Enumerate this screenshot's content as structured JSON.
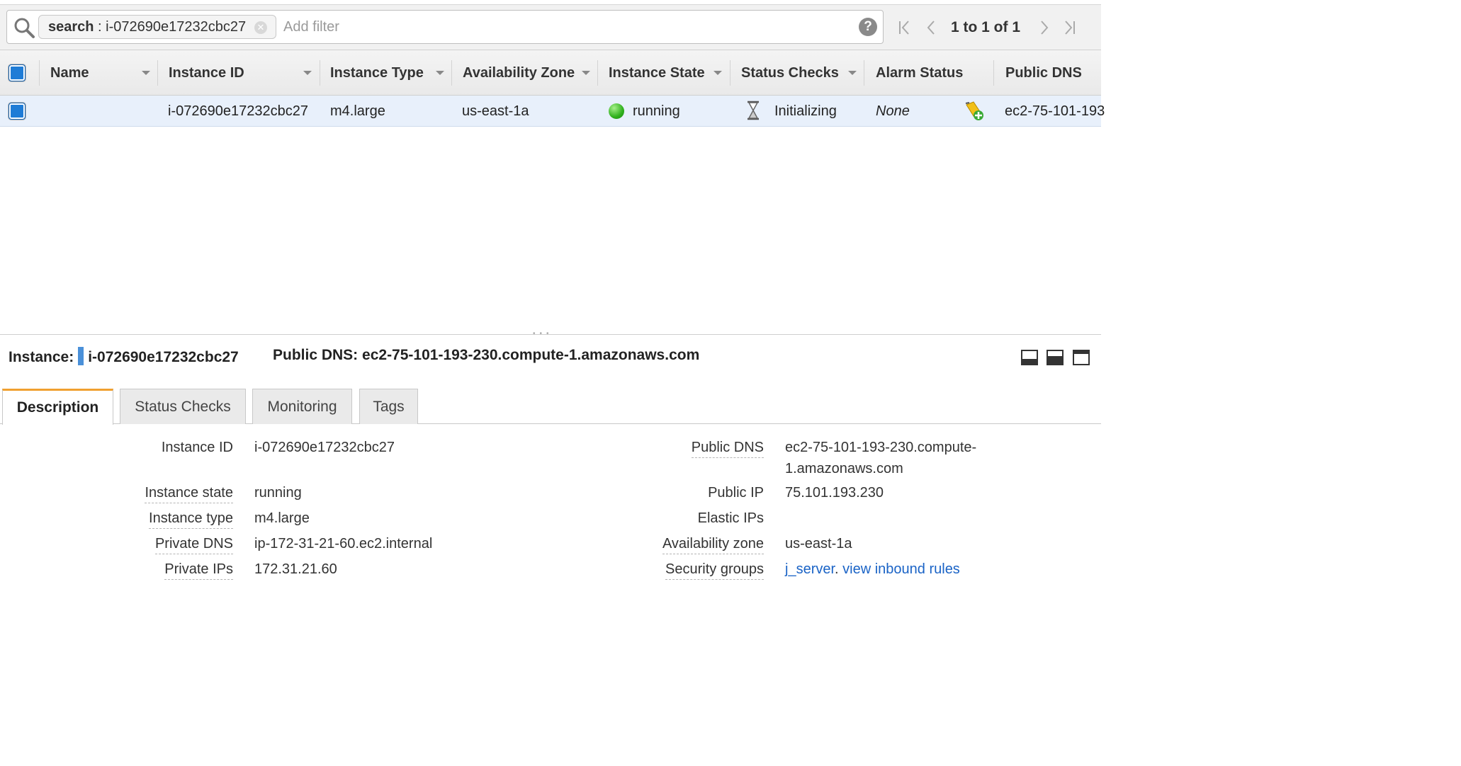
{
  "search": {
    "chip_key": "search",
    "chip_value": "i-072690e17232cbc27",
    "placeholder": "Add filter"
  },
  "pagination": {
    "text": "1 to 1 of 1"
  },
  "columns": {
    "name": "Name",
    "instance_id": "Instance ID",
    "instance_type": "Instance Type",
    "availability_zone": "Availability Zone",
    "instance_state": "Instance State",
    "status_checks": "Status Checks",
    "alarm_status": "Alarm Status",
    "public_dns": "Public DNS"
  },
  "rows": [
    {
      "name": "",
      "instance_id": "i-072690e17232cbc27",
      "instance_type": "m4.large",
      "availability_zone": "us-east-1a",
      "instance_state": "running",
      "status_checks": "Initializing",
      "alarm_status": "None",
      "public_dns": "ec2-75-101-193"
    }
  ],
  "detail": {
    "instance_label": "Instance:",
    "instance_id": "i-072690e17232cbc27",
    "public_dns_label": "Public DNS:",
    "public_dns": "ec2-75-101-193-230.compute-1.amazonaws.com"
  },
  "tabs": [
    "Description",
    "Status Checks",
    "Monitoring",
    "Tags"
  ],
  "description": {
    "left": [
      {
        "label": "Instance ID",
        "value": "i-072690e17232cbc27"
      },
      {
        "label": "Instance state",
        "value": "running"
      },
      {
        "label": "Instance type",
        "value": "m4.large"
      },
      {
        "label": "Private DNS",
        "value": "ip-172-31-21-60.ec2.internal"
      },
      {
        "label": "Private IPs",
        "value": "172.31.21.60"
      }
    ],
    "right": [
      {
        "label": "Public DNS",
        "value_line1": "ec2-75-101-193-230.compute-",
        "value_line2": "1.amazonaws.com"
      },
      {
        "label": "Public IP",
        "value": "75.101.193.230"
      },
      {
        "label": "Elastic IPs",
        "value": ""
      },
      {
        "label": "Availability zone",
        "value": "us-east-1a"
      },
      {
        "label": "Security groups",
        "link1": "j_server",
        "sep": ". ",
        "link2": "view inbound rules"
      }
    ]
  },
  "colors": {
    "accent_tab": "#f0a030",
    "link": "#1a63c6",
    "row_selected": "#e8f0fb",
    "checkbox": "#1f7cd6",
    "running": "#2fb01d"
  },
  "icons": [
    "search-icon",
    "clear-filter-icon",
    "help-icon",
    "first-page-icon",
    "prev-page-icon",
    "next-page-icon",
    "last-page-icon",
    "hourglass-icon",
    "alarm-add-icon",
    "pane-minimize-icon",
    "pane-half-icon",
    "pane-maximize-icon"
  ]
}
